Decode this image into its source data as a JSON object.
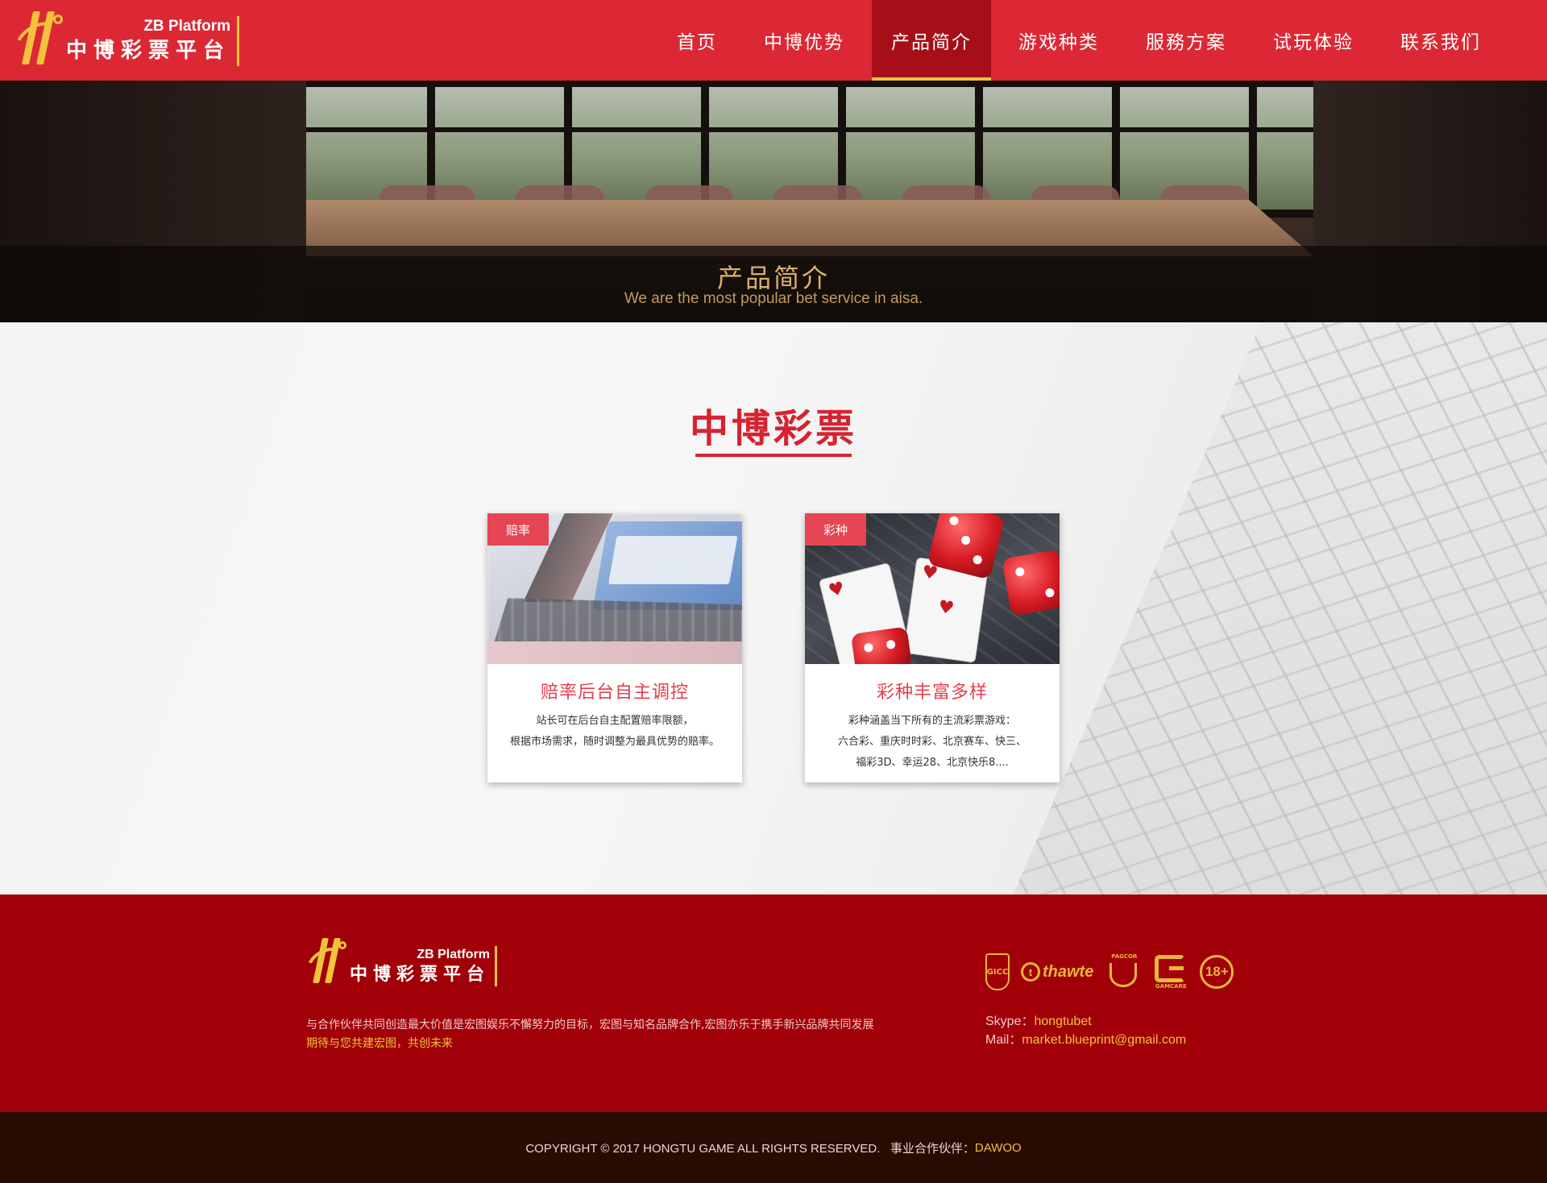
{
  "header": {
    "logo": {
      "en": "ZB Platform",
      "cn": "中博彩票平台"
    },
    "nav": [
      {
        "label": "首页",
        "active": false
      },
      {
        "label": "中博优势",
        "active": false
      },
      {
        "label": "产品简介",
        "active": true
      },
      {
        "label": "游戏种类",
        "active": false
      },
      {
        "label": "服務方案",
        "active": false
      },
      {
        "label": "试玩体验",
        "active": false
      },
      {
        "label": "联系我们",
        "active": false
      }
    ]
  },
  "banner": {
    "title": "产品简介",
    "subtitle": "We are the most popular bet service in aisa."
  },
  "section": {
    "title": "中博彩票",
    "cards": [
      {
        "tag": "赔率",
        "image_icon": "laptop-image",
        "title": "赔率后台自主调控",
        "desc": [
          "站长可在后台自主配置赔率限额，",
          "根据市场需求，随时调整为最具优势的赔率。"
        ]
      },
      {
        "tag": "彩种",
        "image_icon": "dice-cards-image",
        "title": "彩种丰富多样",
        "desc": [
          "彩种涵盖当下所有的主流彩票游戏：",
          "六合彩、重庆时时彩、北京赛车、快三、",
          "福彩3D、幸运28、北京快乐8...."
        ]
      }
    ]
  },
  "footer": {
    "logo": {
      "en": "ZB Platform",
      "cn": "中博彩票平台"
    },
    "desc_line1": "与合作伙伴共同创造最大价值是宏图娱乐不懈努力的目标，宏图与知名品牌合作,宏图亦乐于携手新兴品牌共同发展",
    "desc_line2": "期待与您共建宏图，共创未来",
    "badges": {
      "shield": "GICC",
      "thawte": "thawte",
      "thawte_mark": "t",
      "pagcor": "PAGCOR",
      "gamcare": "GAMCARE",
      "age": "18+"
    },
    "contact": {
      "skype_label": "Skype：",
      "skype": "hongtubet",
      "mail_label": "Mail：",
      "mail": "market.blueprint@gmail.com"
    }
  },
  "copyright": {
    "text": "COPYRIGHT © 2017 HONGTU GAME ALL RIGHTS RESERVED.   事业合作伙伴：",
    "partner": "DAWOO"
  },
  "colors": {
    "header_red": "#dc2834",
    "active_nav": "#a60f17",
    "gold": "#f2c23a",
    "footer_red": "#a10008",
    "copyright_bg": "#2a0b04",
    "title_red": "#d6232f"
  }
}
